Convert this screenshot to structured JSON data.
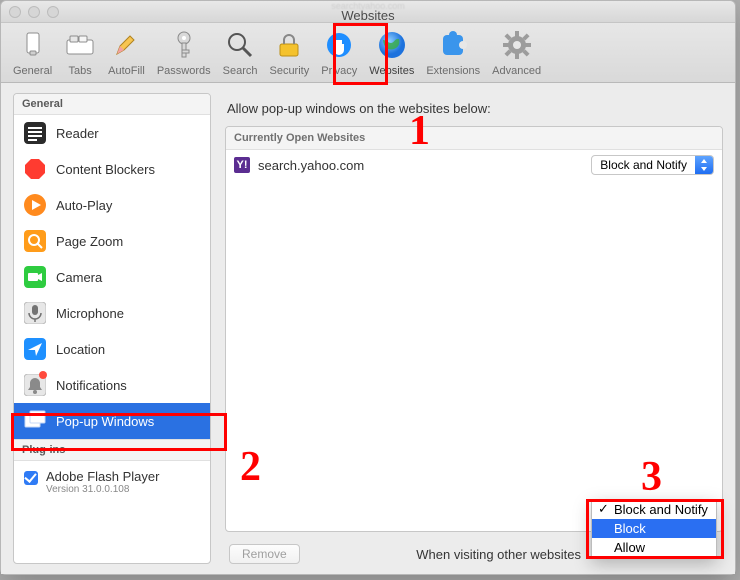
{
  "window": {
    "obscured_title": "searchtyahoo.com",
    "subtitle": "Websites"
  },
  "toolbar": {
    "items": [
      {
        "id": "general",
        "label": "General"
      },
      {
        "id": "tabs",
        "label": "Tabs"
      },
      {
        "id": "autofill",
        "label": "AutoFill"
      },
      {
        "id": "passwords",
        "label": "Passwords"
      },
      {
        "id": "search",
        "label": "Search"
      },
      {
        "id": "security",
        "label": "Security"
      },
      {
        "id": "privacy",
        "label": "Privacy"
      },
      {
        "id": "websites",
        "label": "Websites",
        "selected": true
      },
      {
        "id": "extensions",
        "label": "Extensions"
      },
      {
        "id": "advanced",
        "label": "Advanced"
      }
    ]
  },
  "sidebar": {
    "group1_label": "General",
    "items": [
      {
        "id": "reader",
        "label": "Reader"
      },
      {
        "id": "content-blockers",
        "label": "Content Blockers"
      },
      {
        "id": "auto-play",
        "label": "Auto-Play"
      },
      {
        "id": "page-zoom",
        "label": "Page Zoom"
      },
      {
        "id": "camera",
        "label": "Camera"
      },
      {
        "id": "microphone",
        "label": "Microphone"
      },
      {
        "id": "location",
        "label": "Location"
      },
      {
        "id": "notifications",
        "label": "Notifications",
        "badge": true
      },
      {
        "id": "popups",
        "label": "Pop-up Windows",
        "selected": true
      }
    ],
    "group2_label": "Plug-ins",
    "plugin": {
      "name": "Adobe Flash Player",
      "version": "Version 31.0.0.108",
      "checked": true
    }
  },
  "detail": {
    "heading": "Allow pop-up windows on the websites below:",
    "list_header": "Currently Open Websites",
    "rows": [
      {
        "site": "search.yahoo.com",
        "setting": "Block and Notify"
      }
    ],
    "remove_label": "Remove",
    "other_label": "When visiting other websites",
    "other_dropdown": {
      "options": [
        "Block and Notify",
        "Block",
        "Allow"
      ],
      "checked": "Block and Notify",
      "highlighted": "Block"
    }
  },
  "annotations": {
    "n1": "1",
    "n2": "2",
    "n3": "3"
  }
}
